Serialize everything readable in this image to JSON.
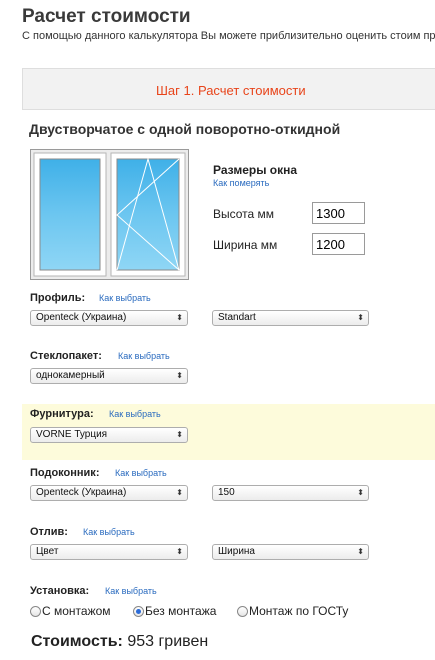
{
  "header": {
    "title": "Расчет стоимости",
    "intro": "С помощью данного калькулятора Вы можете приблизительно оценить стоим продаж"
  },
  "step": {
    "label": "Шаг 1. Расчет стоимости"
  },
  "window": {
    "title": "Двустворчатое с одной поворотно-откидной",
    "sizes_heading": "Размеры окна",
    "measure_link": "Как померять",
    "height_label": "Высота мм",
    "height_value": "1300",
    "width_label": "Ширина мм",
    "width_value": "1200"
  },
  "sections": {
    "profile": {
      "label": "Профиль:",
      "link": "Как выбрать",
      "select1": "Openteck (Украина)",
      "select2": "Standart"
    },
    "glass": {
      "label": "Стеклопакет:",
      "link": "Как выбрать",
      "select1": "однокамерный"
    },
    "fittings": {
      "label": "Фурнитура:",
      "link": "Как выбрать",
      "select1": "VORNE Турция"
    },
    "sill": {
      "label": "Подоконник:",
      "link": "Как выбрать",
      "select1": "Openteck (Украина)",
      "select2": "150"
    },
    "drip": {
      "label": "Отлив:",
      "link": "Как выбрать",
      "select1": "Цвет",
      "select2": "Ширина"
    },
    "install": {
      "label": "Установка:",
      "link": "Как выбрать",
      "options": [
        "С монтажом",
        "Без монтажа",
        "Монтаж по ГОСТу"
      ],
      "selected": "Без монтажа"
    }
  },
  "cost": {
    "label": "Стоимость:",
    "value": "953 гривен"
  },
  "colors": {
    "accent": "#e8441a",
    "link": "#2a6bbf",
    "highlight": "#fdfbdb",
    "glass": "#44b2ea"
  }
}
